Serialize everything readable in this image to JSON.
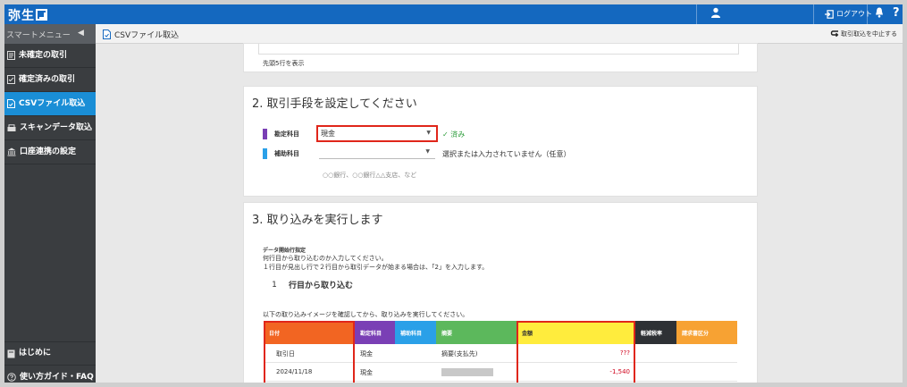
{
  "header": {
    "logo_text": "弥生",
    "logout_label": "ログアウト",
    "help_label": "?"
  },
  "subbar": {
    "smart_menu_label": "スマートメニュー",
    "page_title": "CSVファイル取込",
    "cancel_import_label": "取引取込を中止する"
  },
  "sidebar": {
    "items": [
      {
        "label": "未確定の取引"
      },
      {
        "label": "確定済みの取引"
      },
      {
        "label": "CSVファイル取込"
      },
      {
        "label": "スキャンデータ取込"
      },
      {
        "label": "口座連携の設定"
      }
    ],
    "bottom": [
      {
        "label": "はじめに"
      },
      {
        "label": "使い方ガイド・FAQ"
      }
    ]
  },
  "preview": {
    "note": "先頭5行を表示"
  },
  "step2": {
    "title": "2. 取引手段を設定してください",
    "account_label": "勘定科目",
    "account_value": "現金",
    "account_status": "✓ 済み",
    "sub_account_label": "補助科目",
    "sub_account_status": "選択または入力されていません（任意）",
    "sub_account_hint": "○○銀行、○○銀行△△支店、など"
  },
  "step3": {
    "title": "3. 取り込みを実行します",
    "start_row_heading": "データ開始行指定",
    "start_row_desc1": "何行目から取り込むのか入力してください。",
    "start_row_desc2": "１行目が見出し行で２行目から取引データが始まる場合は、「2」を入力します。",
    "start_row_value": "1",
    "start_row_suffix": "行目から取り込む",
    "preview_instruction": "以下の取り込みイメージを確認してから、取り込みを実行してください。",
    "columns": [
      "日付",
      "勘定科目",
      "補助科目",
      "摘要",
      "金額",
      "軽減税率",
      "請求書区分"
    ],
    "column_colors": [
      "#f26522",
      "#7a3fb5",
      "#2aa0e8",
      "#5cb85c",
      "#ffec3d",
      "#2e3135",
      "#f7a233"
    ],
    "rows": [
      {
        "date": "取引日",
        "account": "現金",
        "sub": "",
        "memo": "摘要(支払先)",
        "amount": "???",
        "tax": "",
        "invoice": ""
      },
      {
        "date": "2024/11/18",
        "account": "現金",
        "sub": "",
        "memo": "",
        "amount": "-1,540",
        "tax": "",
        "invoice": ""
      }
    ]
  }
}
